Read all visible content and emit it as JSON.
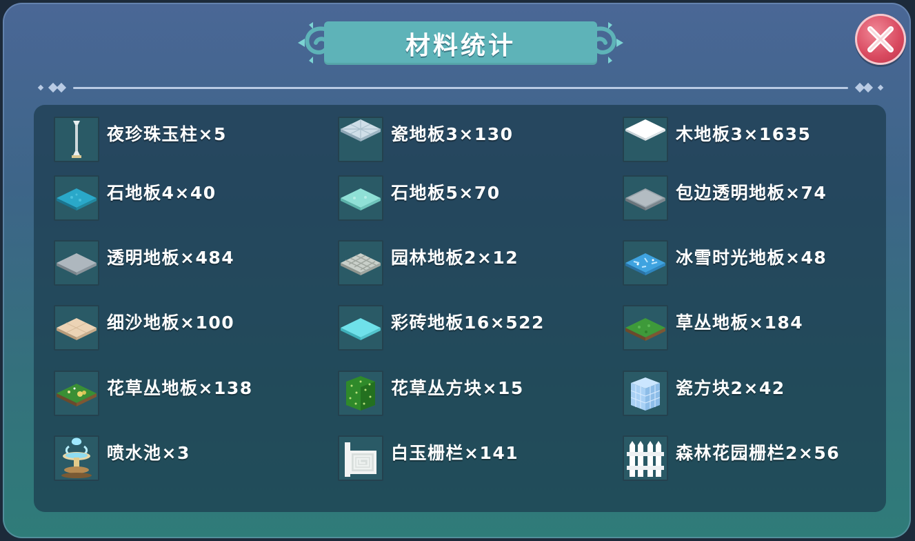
{
  "title": "材料统计",
  "close_icon": "close-x-icon",
  "colors": {
    "banner": "#5eb3b8",
    "close": "#d94a60",
    "panel": "#1c3c4e"
  },
  "items": [
    {
      "label": "夜珍珠玉柱×5",
      "icon": "pillar-icon"
    },
    {
      "label": "瓷地板3×130",
      "icon": "tile-floor-icon"
    },
    {
      "label": "木地板3×1635",
      "icon": "white-floor-icon"
    },
    {
      "label": "石地板4×40",
      "icon": "blue-stone-floor-icon"
    },
    {
      "label": "石地板5×70",
      "icon": "aqua-stone-floor-icon"
    },
    {
      "label": "包边透明地板×74",
      "icon": "edged-clear-floor-icon"
    },
    {
      "label": "透明地板×484",
      "icon": "clear-floor-icon"
    },
    {
      "label": "园林地板2×12",
      "icon": "garden-floor-icon"
    },
    {
      "label": "冰雪时光地板×48",
      "icon": "ice-floor-icon"
    },
    {
      "label": "细沙地板×100",
      "icon": "sand-floor-icon"
    },
    {
      "label": "彩砖地板16×522",
      "icon": "cyan-tile-floor-icon"
    },
    {
      "label": "草丛地板×184",
      "icon": "grass-floor-icon"
    },
    {
      "label": "花草丛地板×138",
      "icon": "flower-grass-floor-icon"
    },
    {
      "label": "花草丛方块×15",
      "icon": "flower-bush-block-icon"
    },
    {
      "label": "瓷方块2×42",
      "icon": "porcelain-block-icon"
    },
    {
      "label": "喷水池×3",
      "icon": "fountain-icon"
    },
    {
      "label": "白玉栅栏×141",
      "icon": "jade-fence-icon"
    },
    {
      "label": "森林花园栅栏2×56",
      "icon": "garden-fence-icon"
    }
  ]
}
